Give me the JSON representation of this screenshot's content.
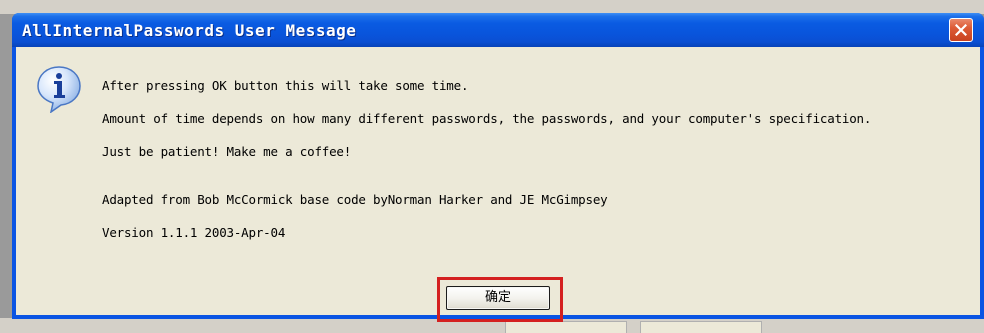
{
  "window": {
    "title": "AllInternalPasswords User Message",
    "close_icon": "close-icon"
  },
  "message": {
    "icon": "info-icon",
    "lines": [
      "After pressing OK button this will take some time.",
      "Amount of time depends on how many different passwords, the passwords, and your computer's specification.",
      "Just be patient! Make me a coffee!",
      "Adapted from Bob McCormick base code byNorman Harker and JE McGimpsey",
      "Version 1.1.1 2003-Apr-04"
    ]
  },
  "buttons": {
    "ok_label": "确定"
  },
  "colors": {
    "titlebar": "#0a54e3",
    "client": "#ece9d8",
    "close": "#dd5b36",
    "highlight": "#d42020"
  }
}
